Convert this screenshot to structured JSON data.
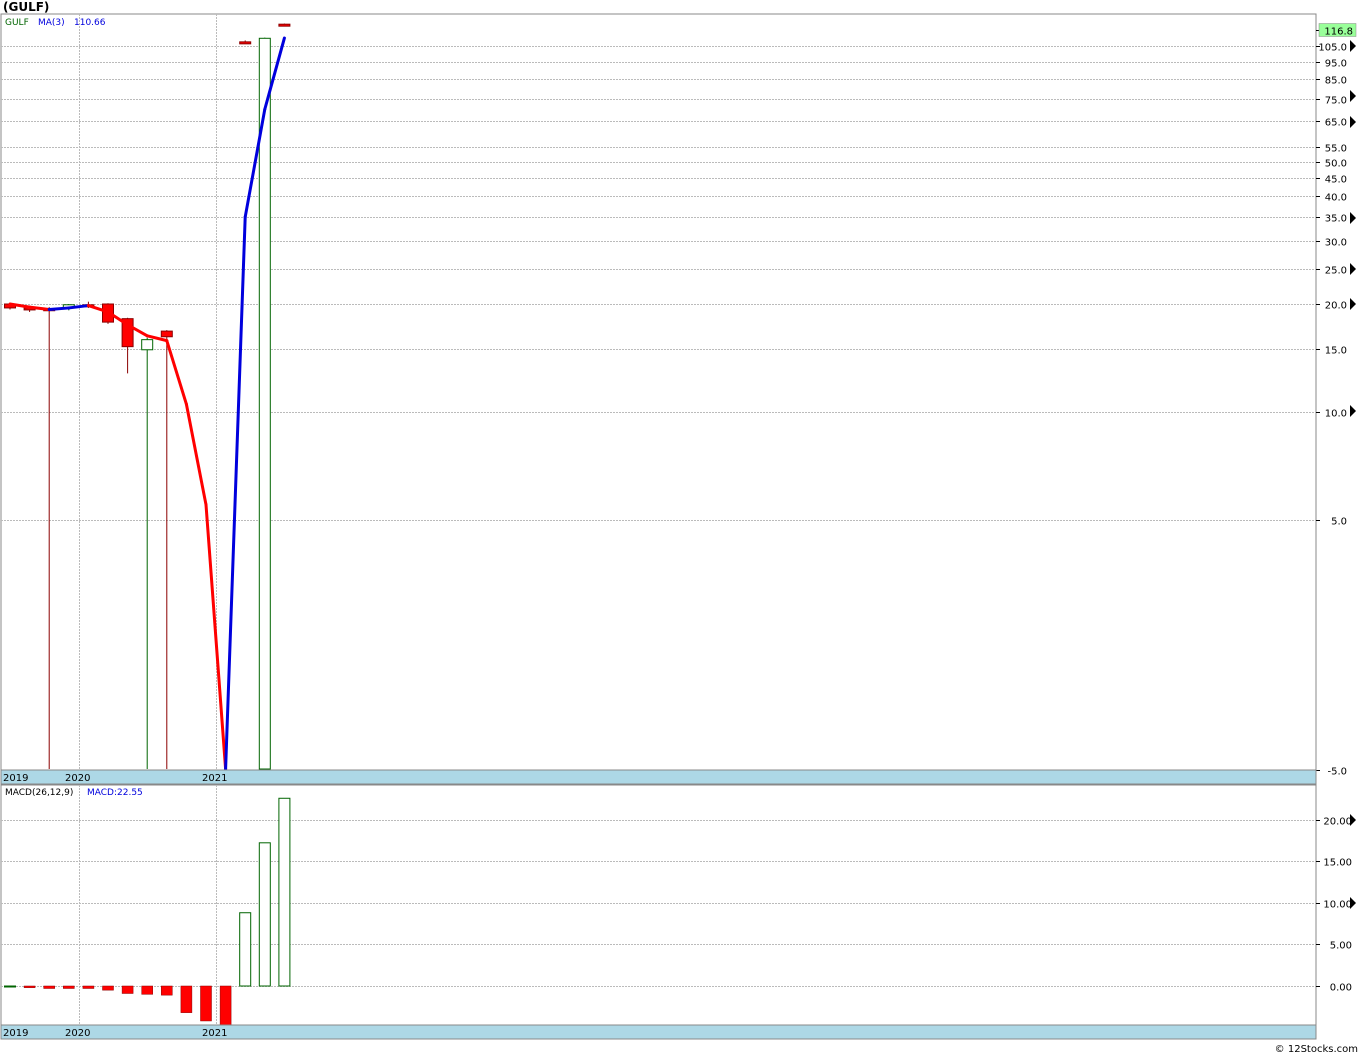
{
  "title": "(GULF)",
  "footer": "© 12Stocks.com",
  "chart_data": [
    {
      "type": "candlestick",
      "scale": "log",
      "legend": {
        "symbol": "GULF",
        "ma_label": "MA(3)",
        "ma_value": "110.66"
      },
      "colors": {
        "up": "#006400",
        "down": "#ff0000",
        "ma_up": "#0000dd",
        "ma_down": "#ff0000",
        "last_price_bg": "#99ff99"
      },
      "last_price_label": "116.8",
      "y_ticks": [
        {
          "v": 116.8,
          "label": "116.8"
        },
        {
          "v": 105,
          "label": "105.0"
        },
        {
          "v": 95,
          "label": "95.0"
        },
        {
          "v": 85,
          "label": "85.0"
        },
        {
          "v": 75,
          "label": "75.0"
        },
        {
          "v": 65,
          "label": "65.0"
        },
        {
          "v": 55,
          "label": "55.0"
        },
        {
          "v": 50,
          "label": "50.0"
        },
        {
          "v": 45,
          "label": "45.0"
        },
        {
          "v": 40,
          "label": "40.0"
        },
        {
          "v": 35,
          "label": "35.0"
        },
        {
          "v": 30,
          "label": "30.0"
        },
        {
          "v": 25,
          "label": "25.0"
        },
        {
          "v": 20,
          "label": "20.0"
        },
        {
          "v": 15,
          "label": "15.0"
        },
        {
          "v": 10,
          "label": "10.0"
        },
        {
          "v": 5,
          "label": "5.0"
        },
        {
          "v": 1,
          "label": "-5.0"
        }
      ],
      "x_labels": [
        {
          "i": 0,
          "label": "2019"
        },
        {
          "i": 4,
          "label": "2020"
        },
        {
          "i": 11,
          "label": "2021"
        }
      ],
      "candles": [
        {
          "o": 20.0,
          "h": 20.2,
          "l": 19.3,
          "c": 19.5,
          "dir": "down"
        },
        {
          "o": 19.5,
          "h": 19.8,
          "l": 19.0,
          "c": 19.3,
          "dir": "down"
        },
        {
          "o": 19.4,
          "h": 19.6,
          "l": 1.0,
          "c": 19.2,
          "dir": "down"
        },
        {
          "o": 19.5,
          "h": 20.0,
          "l": 19.2,
          "c": 19.9,
          "dir": "up"
        },
        {
          "o": 19.9,
          "h": 20.3,
          "l": 19.5,
          "c": 19.7,
          "dir": "down"
        },
        {
          "o": 20.0,
          "h": 20.1,
          "l": 17.6,
          "c": 17.8,
          "dir": "down"
        },
        {
          "o": 18.2,
          "h": 18.3,
          "l": 12.8,
          "c": 15.2,
          "dir": "down"
        },
        {
          "o": 14.9,
          "h": 16.1,
          "l": 1.0,
          "c": 15.9,
          "dir": "up"
        },
        {
          "o": 16.8,
          "h": 16.9,
          "l": 1.0,
          "c": 16.2,
          "dir": "down"
        },
        {
          "o": null,
          "h": null,
          "l": null,
          "c": null,
          "dir": "none"
        },
        {
          "o": null,
          "h": null,
          "l": null,
          "c": null,
          "dir": "none"
        },
        {
          "o": null,
          "h": null,
          "l": null,
          "c": null,
          "dir": "none"
        },
        {
          "o": 108.0,
          "h": 109.0,
          "l": 106.5,
          "c": 107.0,
          "dir": "down"
        },
        {
          "o": 1.0,
          "h": 111.0,
          "l": 1.0,
          "c": 110.5,
          "dir": "up"
        },
        {
          "o": 121.0,
          "h": 121.5,
          "l": 119.5,
          "c": 120.0,
          "dir": "down"
        }
      ],
      "ma": [
        20.0,
        19.6,
        19.3,
        19.5,
        19.8,
        19.0,
        17.5,
        16.3,
        15.8,
        10.5,
        5.5,
        1.0,
        35.0,
        70.0,
        110.66
      ]
    },
    {
      "type": "bar",
      "title": "MACD(26,12,9)",
      "value_label": "MACD:22.55",
      "y_ticks": [
        {
          "v": 20,
          "label": "20.00"
        },
        {
          "v": 15,
          "label": "15.00"
        },
        {
          "v": 10,
          "label": "10.00"
        },
        {
          "v": 5,
          "label": "5.00"
        },
        {
          "v": 0,
          "label": "0.00"
        }
      ],
      "x_labels": [
        {
          "i": 0,
          "label": "2019"
        },
        {
          "i": 4,
          "label": "2020"
        },
        {
          "i": 11,
          "label": "2021"
        }
      ],
      "values": [
        0.0,
        -0.2,
        -0.3,
        -0.3,
        -0.3,
        -0.5,
        -0.9,
        -1.0,
        -1.1,
        -3.2,
        -4.2,
        -4.8,
        8.8,
        17.2,
        22.55
      ]
    }
  ]
}
